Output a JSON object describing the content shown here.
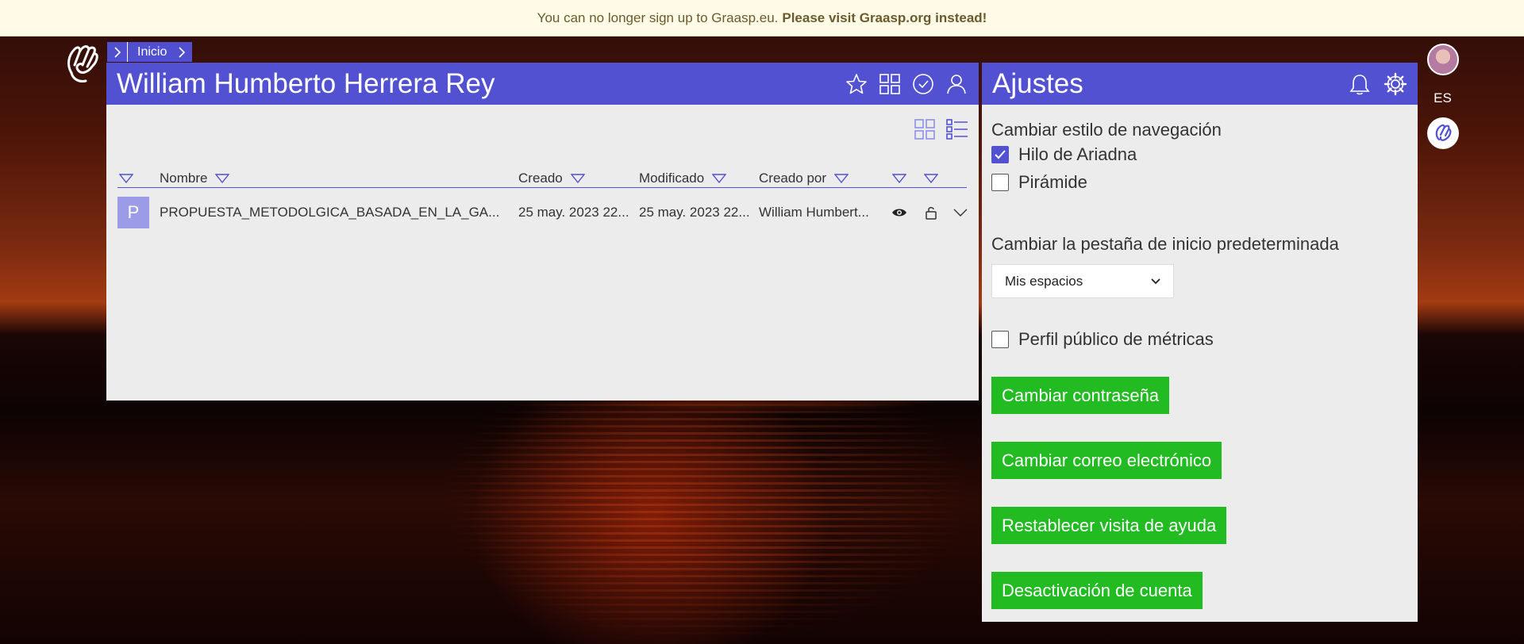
{
  "banner": {
    "text": "You can no longer sign up to Graasp.eu.",
    "bold": "Please visit Graasp.org instead!"
  },
  "breadcrumb": {
    "home": "Inicio"
  },
  "left_panel": {
    "title": "William Humberto Herrera Rey",
    "columns": [
      "Nombre",
      "Creado",
      "Modificado",
      "Creado por"
    ],
    "rows": [
      {
        "initial": "P",
        "name": "PROPUESTA_METODOLGICA_BASADA_EN_LA_GA...",
        "created": "25 may. 2023 22...",
        "modified": "25 may. 2023 22...",
        "creator": "William Humbert..."
      }
    ]
  },
  "settings": {
    "title": "Ajustes",
    "nav_style_label": "Cambiar estilo de navegación",
    "nav_options": [
      {
        "label": "Hilo de Ariadna",
        "checked": true
      },
      {
        "label": "Pirámide",
        "checked": false
      }
    ],
    "default_tab_label": "Cambiar la pestaña de inicio predeterminada",
    "default_tab_value": "Mis espacios",
    "metrics_label": "Perfil público de métricas",
    "metrics_checked": false,
    "buttons": {
      "change_password": "Cambiar contraseña",
      "change_email": "Cambiar correo electrónico",
      "reset_tour": "Restablecer visita de ayuda",
      "deactivate": "Desactivación de cuenta"
    }
  },
  "rail": {
    "language": "ES"
  },
  "colors": {
    "accent": "#5151d1",
    "button": "#22bb22",
    "banner_bg": "#fffbe6"
  }
}
